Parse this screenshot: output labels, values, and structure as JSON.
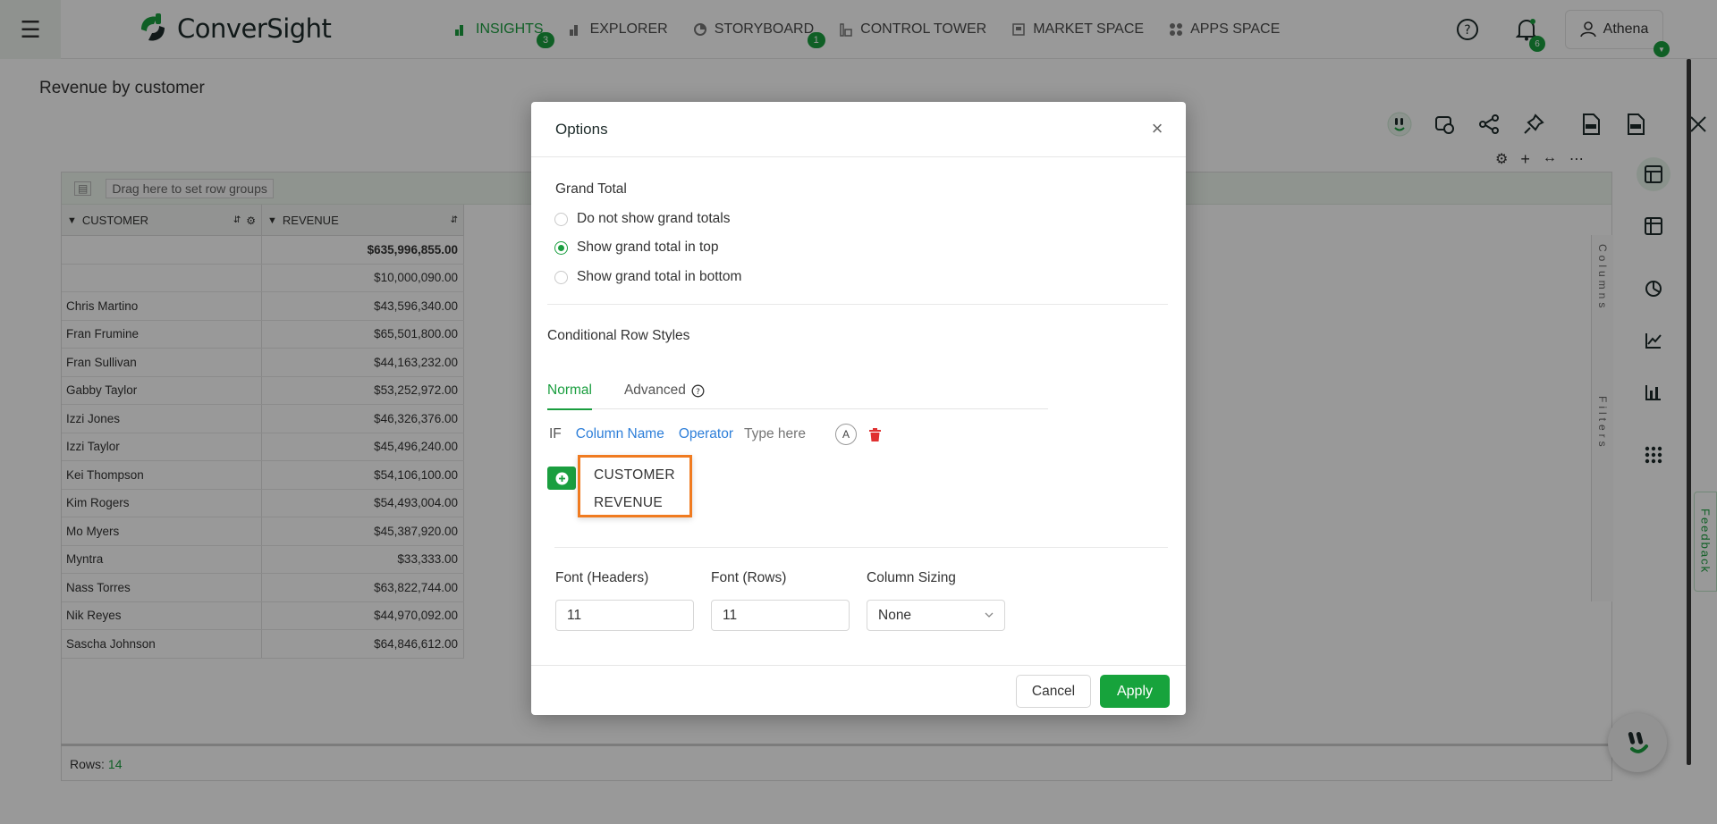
{
  "topbar": {
    "brand": "ConverSight",
    "nav": [
      {
        "label": "INSIGHTS",
        "badge": "3",
        "active": true
      },
      {
        "label": "EXPLORER",
        "badge": ""
      },
      {
        "label": "STORYBOARD",
        "badge": "1"
      },
      {
        "label": "CONTROL TOWER",
        "badge": ""
      },
      {
        "label": "MARKET SPACE",
        "badge": ""
      },
      {
        "label": "APPS SPACE",
        "badge": ""
      }
    ],
    "notifications_count": "6",
    "user_name": "Athena"
  },
  "page": {
    "title": "Revenue by customer"
  },
  "grid": {
    "row_group_hint": "Drag here to set row groups",
    "columns": [
      "CUSTOMER",
      "REVENUE"
    ],
    "rows": [
      {
        "customer": "",
        "revenue": "$635,996,855.00",
        "total": true
      },
      {
        "customer": "",
        "revenue": "$10,000,090.00"
      },
      {
        "customer": "Chris Martino",
        "revenue": "$43,596,340.00"
      },
      {
        "customer": "Fran Frumine",
        "revenue": "$65,501,800.00"
      },
      {
        "customer": "Fran Sullivan",
        "revenue": "$44,163,232.00"
      },
      {
        "customer": "Gabby Taylor",
        "revenue": "$53,252,972.00"
      },
      {
        "customer": "Izzi Jones",
        "revenue": "$46,326,376.00"
      },
      {
        "customer": "Izzi Taylor",
        "revenue": "$45,496,240.00"
      },
      {
        "customer": "Kei Thompson",
        "revenue": "$54,106,100.00"
      },
      {
        "customer": "Kim Rogers",
        "revenue": "$54,493,004.00"
      },
      {
        "customer": "Mo Myers",
        "revenue": "$45,387,920.00"
      },
      {
        "customer": "Myntra",
        "revenue": "$33,333.00"
      },
      {
        "customer": "Nass Torres",
        "revenue": "$63,822,744.00"
      },
      {
        "customer": "Nik Reyes",
        "revenue": "$44,970,092.00"
      },
      {
        "customer": "Sascha Johnson",
        "revenue": "$64,846,612.00"
      }
    ],
    "side_columns_label": "Columns",
    "side_filters_label": "Filters",
    "footer_rows_label": "Rows:",
    "footer_rows_count": "14"
  },
  "feedback_label": "Feedback",
  "modal": {
    "title": "Options",
    "grand_total_label": "Grand Total",
    "grand_total_options": [
      {
        "label": "Do not show grand totals",
        "checked": false
      },
      {
        "label": "Show grand total in top",
        "checked": true
      },
      {
        "label": "Show grand total in bottom",
        "checked": false
      }
    ],
    "conditional_label": "Conditional Row Styles",
    "tabs": [
      {
        "label": "Normal",
        "active": true
      },
      {
        "label": "Advanced",
        "active": false
      }
    ],
    "condition": {
      "if_label": "IF",
      "column_name": "Column Name",
      "operator": "Operator",
      "value_placeholder": "Type here",
      "style_letter": "A"
    },
    "dropdown_options": [
      "CUSTOMER",
      "REVENUE"
    ],
    "font_headers_label": "Font (Headers)",
    "font_headers_value": "11",
    "font_rows_label": "Font (Rows)",
    "font_rows_value": "11",
    "column_sizing_label": "Column Sizing",
    "column_sizing_value": "None",
    "cancel_label": "Cancel",
    "apply_label": "Apply"
  },
  "colors": {
    "accent": "#1a9e3f",
    "link": "#2e7fd9",
    "highlight": "#f07b20",
    "danger": "#e03131"
  }
}
